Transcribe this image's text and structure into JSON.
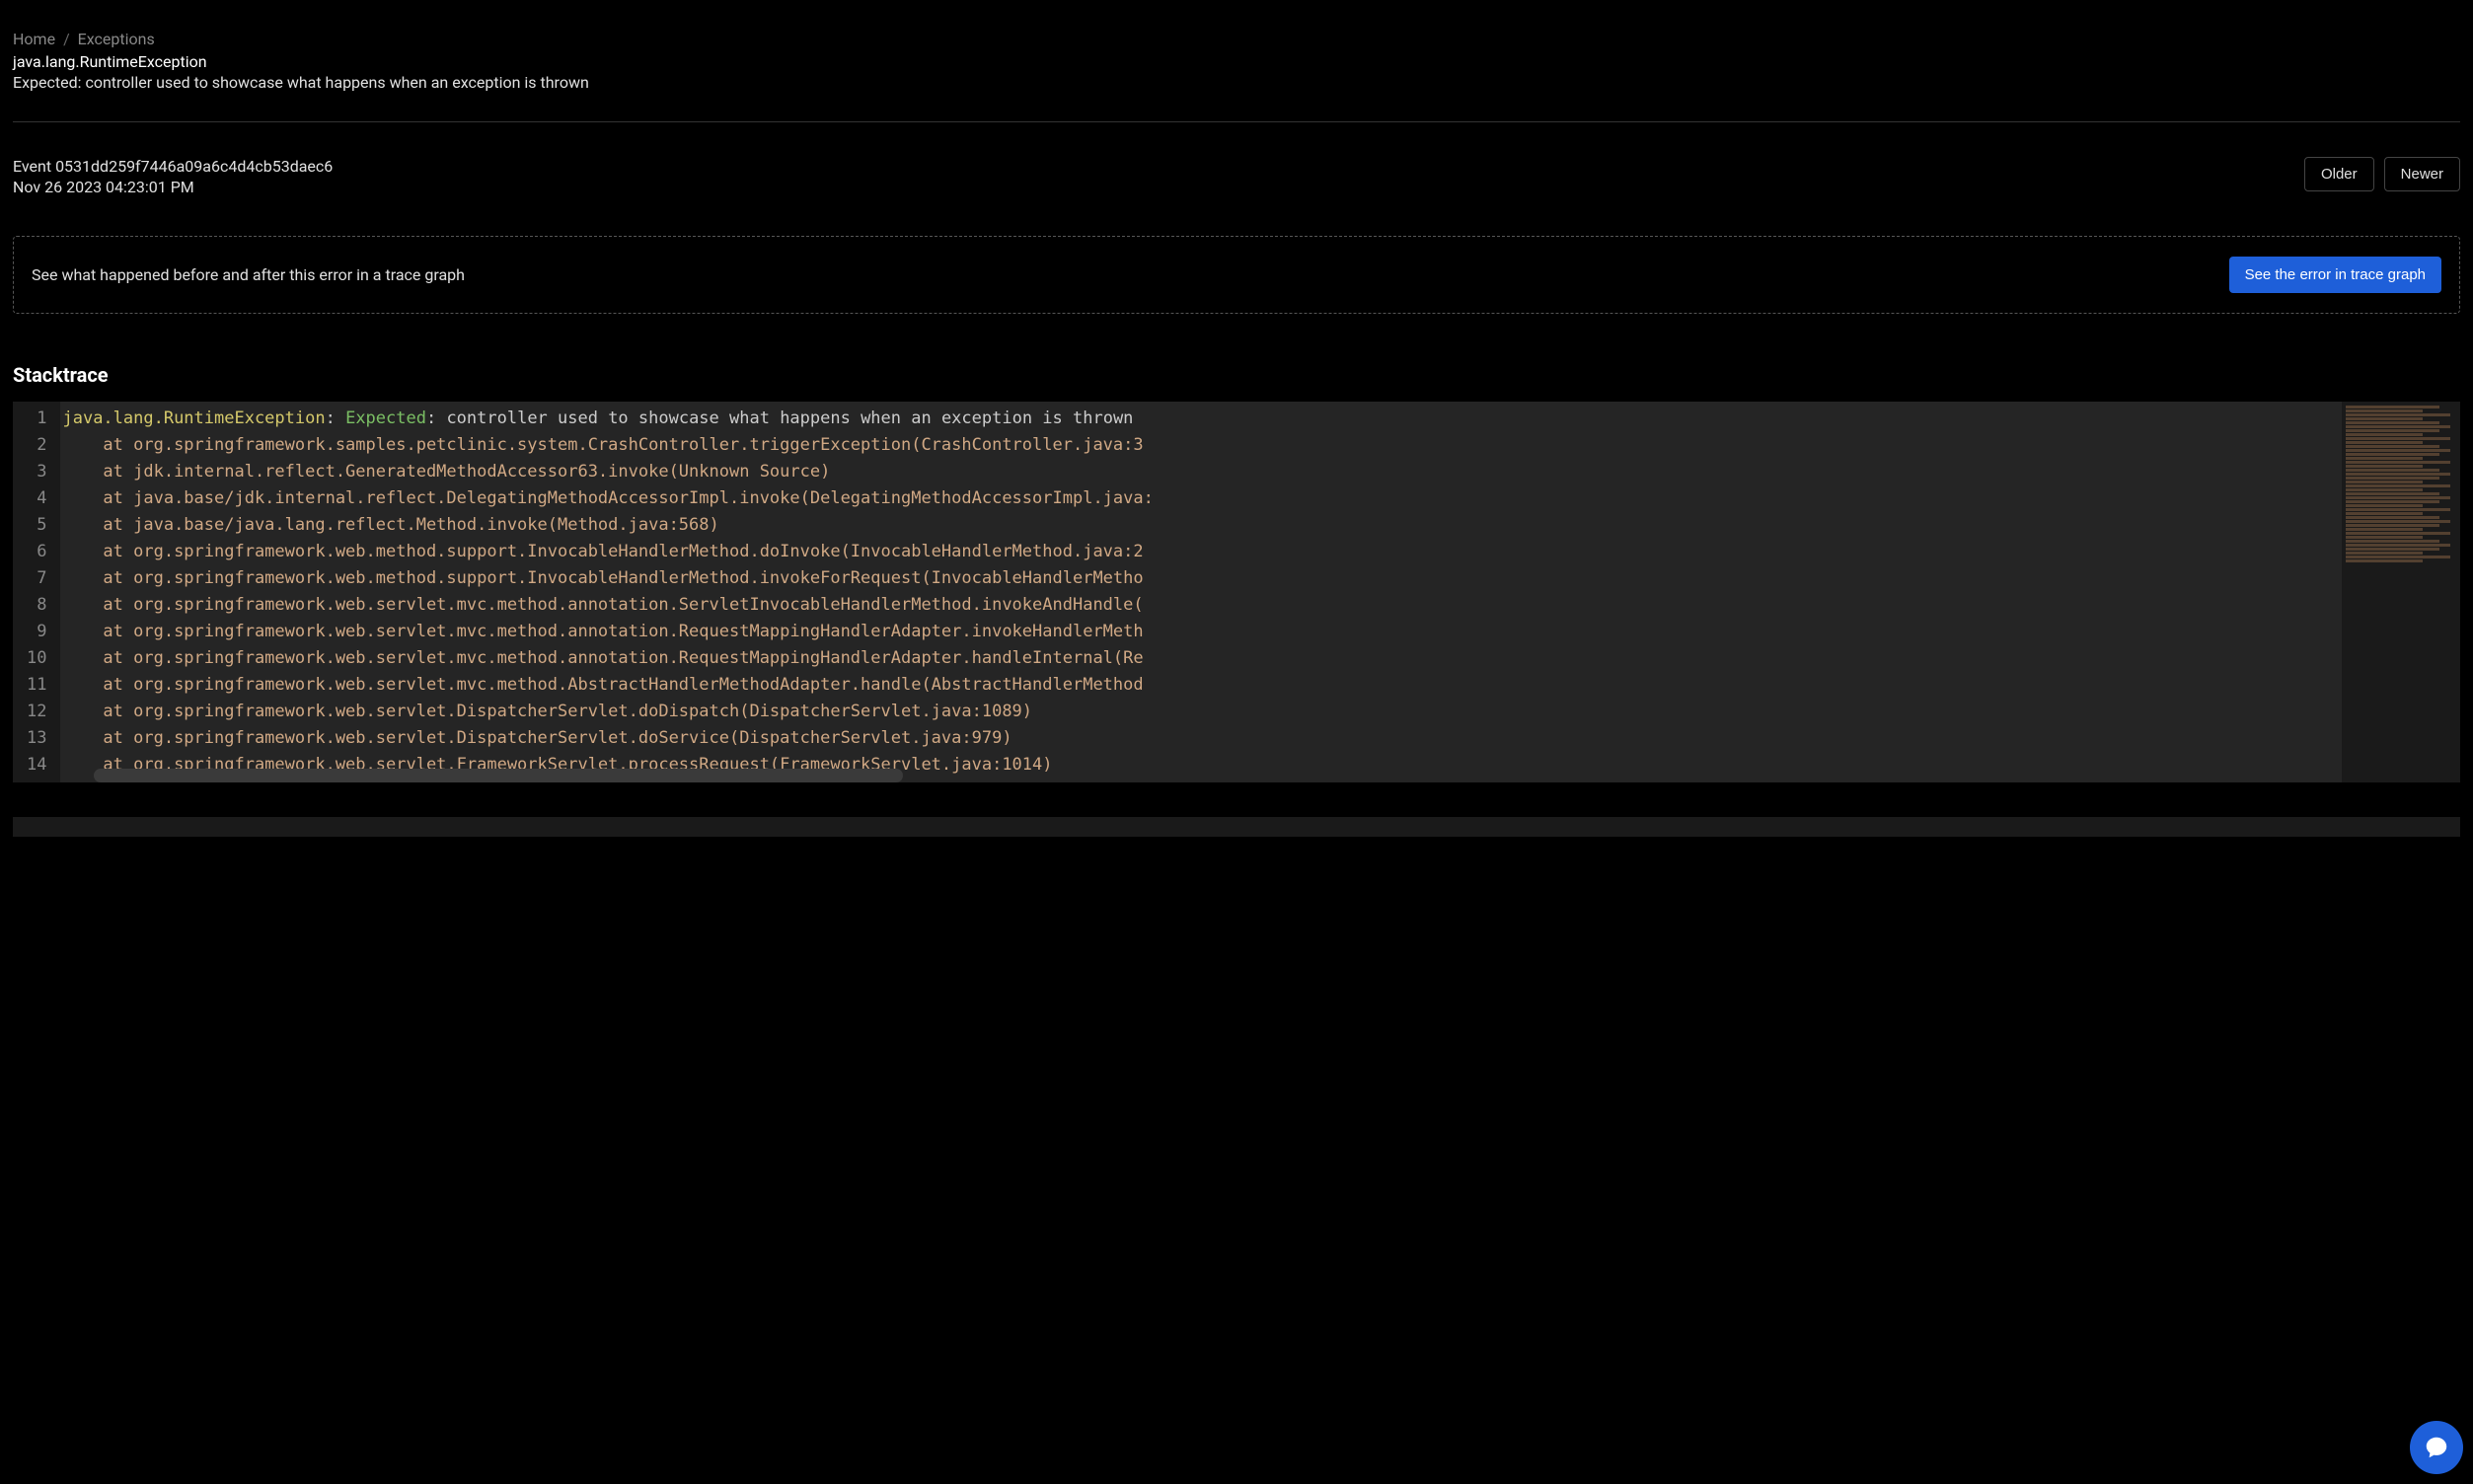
{
  "breadcrumb": {
    "home": "Home",
    "exceptions": "Exceptions"
  },
  "exception": {
    "class": "java.lang.RuntimeException",
    "message": "Expected: controller used to showcase what happens when an exception is thrown"
  },
  "event": {
    "label": "Event",
    "id": "0531dd259f7446a09a6c4d4cb53daec6",
    "timestamp": "Nov 26 2023 04:23:01 PM"
  },
  "nav": {
    "older": "Older",
    "newer": "Newer"
  },
  "trace_banner": {
    "text": "See what happened before and after this error in a trace graph",
    "button": "See the error in trace graph"
  },
  "stacktrace": {
    "heading": "Stacktrace",
    "first_line": {
      "class": "java.lang.RuntimeException",
      "expected": "Expected",
      "rest": "controller used to showcase what happens when an exception is thrown"
    },
    "lines": [
      "    at org.springframework.samples.petclinic.system.CrashController.triggerException(CrashController.java:3",
      "    at jdk.internal.reflect.GeneratedMethodAccessor63.invoke(Unknown Source)",
      "    at java.base/jdk.internal.reflect.DelegatingMethodAccessorImpl.invoke(DelegatingMethodAccessorImpl.java:",
      "    at java.base/java.lang.reflect.Method.invoke(Method.java:568)",
      "    at org.springframework.web.method.support.InvocableHandlerMethod.doInvoke(InvocableHandlerMethod.java:2",
      "    at org.springframework.web.method.support.InvocableHandlerMethod.invokeForRequest(InvocableHandlerMetho",
      "    at org.springframework.web.servlet.mvc.method.annotation.ServletInvocableHandlerMethod.invokeAndHandle(",
      "    at org.springframework.web.servlet.mvc.method.annotation.RequestMappingHandlerAdapter.invokeHandlerMeth",
      "    at org.springframework.web.servlet.mvc.method.annotation.RequestMappingHandlerAdapter.handleInternal(Re",
      "    at org.springframework.web.servlet.mvc.method.AbstractHandlerMethodAdapter.handle(AbstractHandlerMethod",
      "    at org.springframework.web.servlet.DispatcherServlet.doDispatch(DispatcherServlet.java:1089)",
      "    at org.springframework.web.servlet.DispatcherServlet.doService(DispatcherServlet.java:979)",
      "    at org.springframework.web.servlet.FrameworkServlet.processRequest(FrameworkServlet.java:1014)"
    ]
  }
}
